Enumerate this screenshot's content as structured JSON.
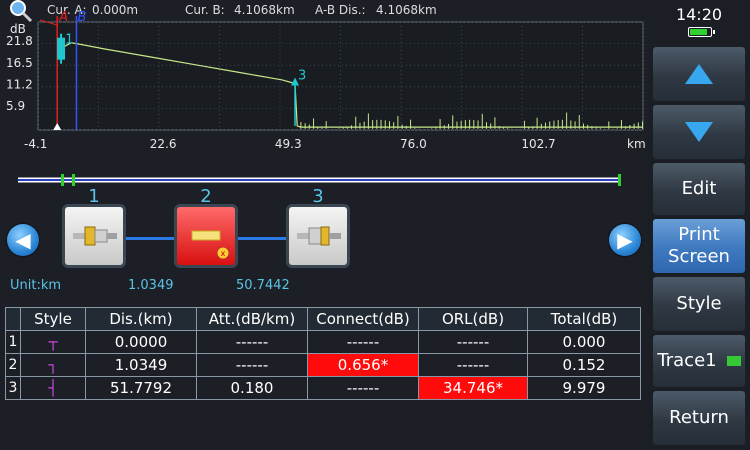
{
  "header": {
    "cur_a_label": "Cur. A:",
    "cur_a_value": "0.000m",
    "cur_b_label": "Cur. B:",
    "cur_b_value": "4.1068km",
    "ab_label": "A-B Dis.:",
    "ab_value": "4.1068km"
  },
  "chart_data": {
    "type": "line",
    "ylabel": "dB",
    "xlabel": "km",
    "y_ticks": [
      "21.8",
      "16.5",
      "11.2",
      "5.9"
    ],
    "x_ticks": [
      "-4.1",
      "22.6",
      "49.3",
      "76.0",
      "102.7"
    ],
    "x_unit": "km",
    "xlim": [
      -4.1,
      125
    ],
    "ylim": [
      0,
      26.5
    ],
    "cursor_a_label": "A",
    "cursor_b_label": "B",
    "cursor_a_x": 0.0,
    "cursor_b_x": 4.1068,
    "series": [
      {
        "x": [
          0,
          1.0,
          3.0,
          5.0,
          10,
          20,
          30,
          40,
          48,
          50.7442,
          51.2,
          52,
          125
        ],
        "y": [
          21.5,
          20.2,
          21.4,
          21.0,
          19.9,
          17.9,
          15.9,
          13.9,
          12.3,
          11.4,
          1.0,
          0.7,
          0.7
        ]
      }
    ],
    "event_markers": [
      {
        "label": "1",
        "x": 1.0349,
        "y": 20.2
      },
      {
        "label": "3",
        "x": 50.7442,
        "y": 11.4
      }
    ]
  },
  "map": {
    "events": [
      {
        "number": "1",
        "type": "connector"
      },
      {
        "number": "2",
        "type": "fault"
      },
      {
        "number": "3",
        "type": "end"
      }
    ],
    "unit_label": "Unit:km",
    "distances": [
      "1.0349",
      "50.7442"
    ]
  },
  "table": {
    "headers": [
      "Style",
      "Dis.(km)",
      "Att.(dB/km)",
      "Connect(dB)",
      "ORL(dB)",
      "Total(dB)"
    ],
    "rows": [
      {
        "num": "1",
        "style": "┬",
        "dis": "0.0000",
        "att": "------",
        "connect": "------",
        "orl": "------",
        "total": "0.000"
      },
      {
        "num": "2",
        "style": "┐",
        "dis": "1.0349",
        "att": "------",
        "connect": "0.656*",
        "orl": "------",
        "total": "0.152"
      },
      {
        "num": "3",
        "style": "┤",
        "dis": "51.7792",
        "att": "0.180",
        "connect": "------",
        "orl": "34.746*",
        "total": "9.979"
      }
    ]
  },
  "sidebar": {
    "time": "14:20",
    "battery_level": 0.85,
    "up_icon": "triangle-up-icon",
    "down_icon": "triangle-down-icon",
    "edit_label": "Edit",
    "print_label": "Print Screen",
    "style_label": "Style",
    "trace_label": "Trace1",
    "return_label": "Return"
  },
  "colors": {
    "trace": "#c8e88a",
    "cursor_a": "#e02020",
    "cursor_b": "#3355ff",
    "marker": "#1ec8d0",
    "accent": "#2a7be6",
    "alert": "#ff0b0b"
  }
}
